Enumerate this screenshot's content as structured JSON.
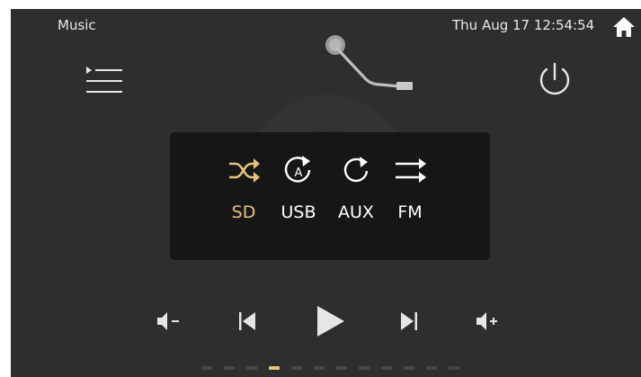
{
  "status_bar": {
    "app_title": "Music",
    "datetime": "Thu Aug 17  12:54:54",
    "home_icon": "home-icon"
  },
  "top_controls": {
    "playlist_icon": "playlist-icon",
    "power_icon": "power-icon"
  },
  "source_panel": {
    "options": [
      {
        "label": "SD",
        "icon": "shuffle-icon",
        "selected": true
      },
      {
        "label": "USB",
        "icon": "repeat-a-icon",
        "selected": false
      },
      {
        "label": "AUX",
        "icon": "repeat-icon",
        "selected": false
      },
      {
        "label": "FM",
        "icon": "sequential-icon",
        "selected": false
      }
    ]
  },
  "transport": {
    "buttons": [
      "volume-down-icon",
      "previous-icon",
      "play-icon",
      "next-icon",
      "volume-up-icon"
    ]
  },
  "pagination": {
    "total_pages": 12,
    "current_page": 4
  },
  "colors": {
    "background": "#2e2e2e",
    "panel": "#161616",
    "accent": "#e7c17c",
    "text": "#ffffff"
  }
}
